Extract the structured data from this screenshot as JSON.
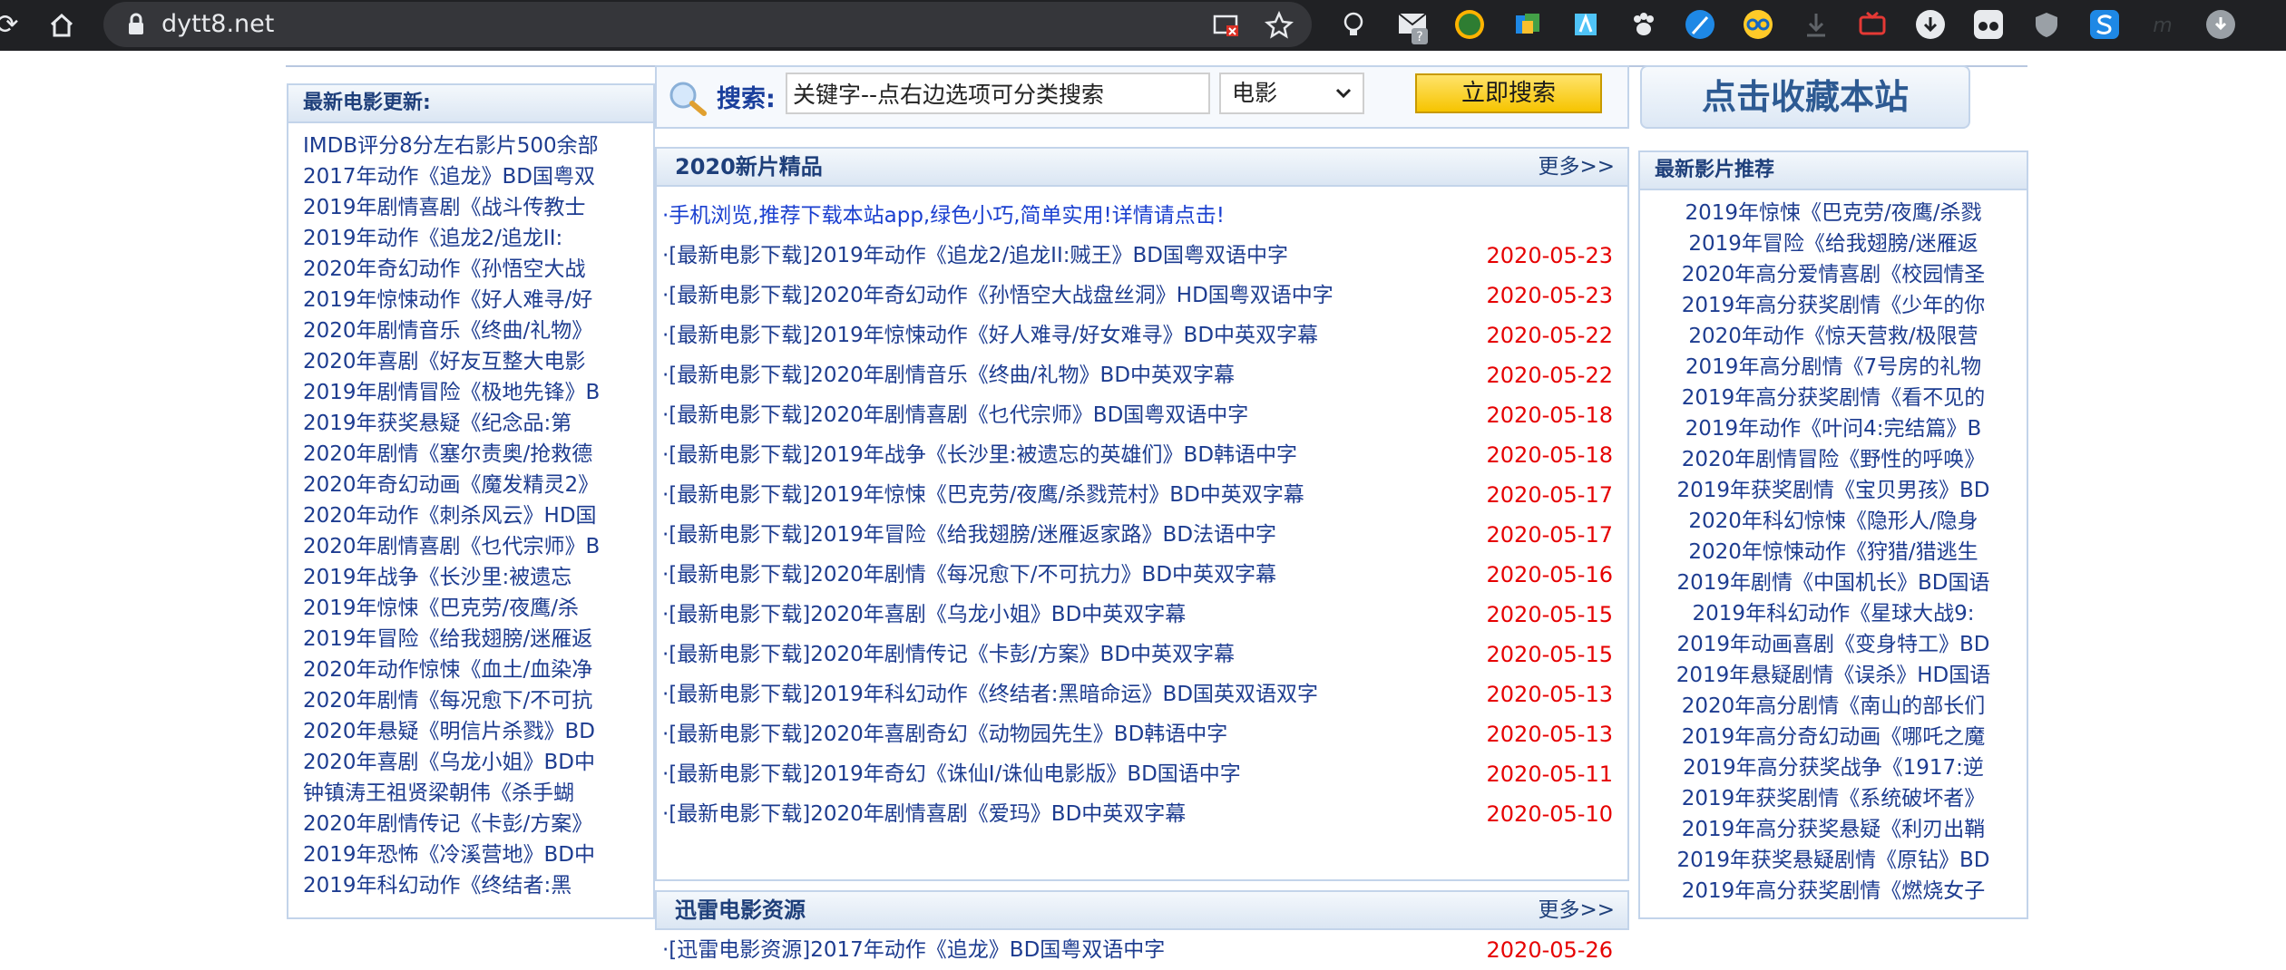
{
  "browser": {
    "url": "dytt8.net",
    "omnibox_icons": [
      "screen-cast-icon",
      "bookmark-star-icon"
    ],
    "extensions": [
      "bulb-icon",
      "mail-icon",
      "compass-icon",
      "doc-icon",
      "stamp-icon",
      "paw-icon",
      "feather-icon",
      "glasses-icon",
      "download-icon",
      "tv-icon",
      "down-arrow-icon",
      "mask-icon",
      "shield-icon",
      "s-icon",
      "m-icon",
      "profile-icon"
    ]
  },
  "search": {
    "label": "搜索:",
    "keyword_value": "关键字--点右边选项可分类搜索",
    "category": "电影",
    "button": "立即搜索"
  },
  "bookmark_button": "点击收藏本站",
  "left_panel": {
    "title": "最新电影更新:",
    "items": [
      "IMDB评分8分左右影片500余部",
      "2017年动作《追龙》BD国粤双",
      "2019年剧情喜剧《战斗传教士",
      "2019年动作《追龙2/追龙II:",
      "2020年奇幻动作《孙悟空大战",
      "2019年惊悚动作《好人难寻/好",
      "2020年剧情音乐《终曲/礼物》",
      "2020年喜剧《好友互整大电影",
      "2019年剧情冒险《极地先锋》B",
      "2019年获奖悬疑《纪念品:第",
      "2020年剧情《塞尔责奥/抢救德",
      "2020年奇幻动画《魔发精灵2》",
      "2020年动作《刺杀风云》HD国",
      "2020年剧情喜剧《乜代宗师》B",
      "2019年战争《长沙里:被遗忘",
      "2019年惊悚《巴克劳/夜鹰/杀",
      "2019年冒险《给我翅膀/迷雁返",
      "2020年动作惊悚《血土/血染净",
      "2020年剧情《每况愈下/不可抗",
      "2020年悬疑《明信片杀戮》BD",
      "2020年喜剧《乌龙小姐》BD中",
      "钟镇涛王祖贤梁朝伟《杀手蝴",
      "2020年剧情传记《卡彭/方案》",
      "2019年恐怖《冷溪营地》BD中",
      "2019年科幻动作《终结者:黑"
    ]
  },
  "new_films": {
    "title": "2020新片精品",
    "more": "更多>>",
    "notice": "·手机浏览,推荐下载本站app,绿色小巧,简单实用!详情请点击!",
    "rows": [
      {
        "title": "·[最新电影下载]2019年动作《追龙2/追龙II:贼王》BD国粤双语中字",
        "date": "2020-05-23"
      },
      {
        "title": "·[最新电影下载]2020年奇幻动作《孙悟空大战盘丝洞》HD国粤双语中字",
        "date": "2020-05-23"
      },
      {
        "title": "·[最新电影下载]2019年惊悚动作《好人难寻/好女难寻》BD中英双字幕",
        "date": "2020-05-22"
      },
      {
        "title": "·[最新电影下载]2020年剧情音乐《终曲/礼物》BD中英双字幕",
        "date": "2020-05-22"
      },
      {
        "title": "·[最新电影下载]2020年剧情喜剧《乜代宗师》BD国粤双语中字",
        "date": "2020-05-18"
      },
      {
        "title": "·[最新电影下载]2019年战争《长沙里:被遗忘的英雄们》BD韩语中字",
        "date": "2020-05-18"
      },
      {
        "title": "·[最新电影下载]2019年惊悚《巴克劳/夜鹰/杀戮荒村》BD中英双字幕",
        "date": "2020-05-17"
      },
      {
        "title": "·[最新电影下载]2019年冒险《给我翅膀/迷雁返家路》BD法语中字",
        "date": "2020-05-17"
      },
      {
        "title": "·[最新电影下载]2020年剧情《每况愈下/不可抗力》BD中英双字幕",
        "date": "2020-05-16"
      },
      {
        "title": "·[最新电影下载]2020年喜剧《乌龙小姐》BD中英双字幕",
        "date": "2020-05-15"
      },
      {
        "title": "·[最新电影下载]2020年剧情传记《卡彭/方案》BD中英双字幕",
        "date": "2020-05-15"
      },
      {
        "title": "·[最新电影下载]2019年科幻动作《终结者:黑暗命运》BD国英双语双字",
        "date": "2020-05-13"
      },
      {
        "title": "·[最新电影下载]2020年喜剧奇幻《动物园先生》BD韩语中字",
        "date": "2020-05-13"
      },
      {
        "title": "·[最新电影下载]2019年奇幻《诛仙I/诛仙电影版》BD国语中字",
        "date": "2020-05-11"
      },
      {
        "title": "·[最新电影下载]2020年剧情喜剧《爱玛》BD中英双字幕",
        "date": "2020-05-10"
      }
    ]
  },
  "xunlei": {
    "title": "迅雷电影资源",
    "more": "更多>>",
    "rows": [
      {
        "title": "·[迅雷电影资源]2017年动作《追龙》BD国粤双语中字",
        "date": "2020-05-26"
      }
    ]
  },
  "right_panel": {
    "title": "最新影片推荐",
    "items": [
      "2019年惊悚《巴克劳/夜鹰/杀戮",
      "2019年冒险《给我翅膀/迷雁返",
      "2020年高分爱情喜剧《校园情圣",
      "2019年高分获奖剧情《少年的你",
      "2020年动作《惊天营救/极限营",
      "2019年高分剧情《7号房的礼物",
      "2019年高分获奖剧情《看不见的",
      "2019年动作《叶问4:完结篇》B",
      "2020年剧情冒险《野性的呼唤》",
      "2019年获奖剧情《宝贝男孩》BD",
      "2020年科幻惊悚《隐形人/隐身",
      "2020年惊悚动作《狩猎/猎逃生",
      "2019年剧情《中国机长》BD国语",
      "2019年科幻动作《星球大战9:",
      "2019年动画喜剧《变身特工》BD",
      "2019年悬疑剧情《误杀》HD国语",
      "2020年高分剧情《南山的部长们",
      "2019年高分奇幻动画《哪吒之魔",
      "2019年高分获奖战争《1917:逆",
      "2019年获奖剧情《系统破坏者》",
      "2019年高分获奖悬疑《利刃出鞘",
      "2019年获奖悬疑剧情《原钻》BD",
      "2019年高分获奖剧情《燃烧女子"
    ]
  }
}
